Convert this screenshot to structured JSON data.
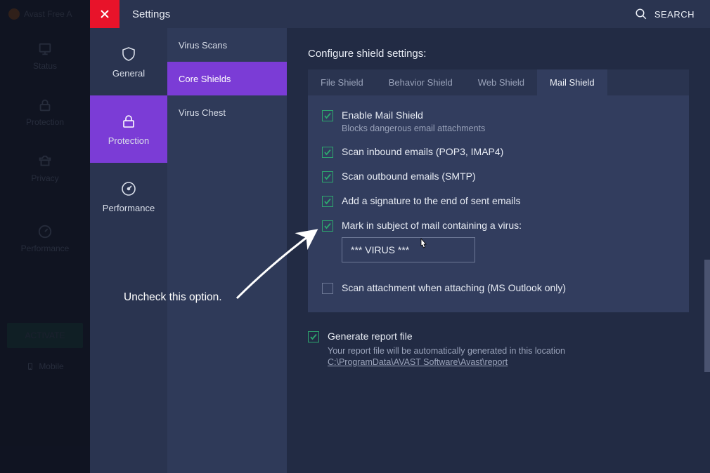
{
  "window": {
    "app_name": "Avast Free A",
    "title": "Settings",
    "search_label": "SEARCH"
  },
  "leftbar": {
    "items": [
      {
        "label": "Status"
      },
      {
        "label": "Protection"
      },
      {
        "label": "Privacy"
      },
      {
        "label": "Performance"
      }
    ],
    "activate": "ACTIVATE",
    "mobile": "Mobile"
  },
  "panel1": [
    {
      "label": "General"
    },
    {
      "label": "Protection"
    },
    {
      "label": "Performance"
    }
  ],
  "panel2": [
    {
      "label": "Virus Scans"
    },
    {
      "label": "Core Shields"
    },
    {
      "label": "Virus Chest"
    }
  ],
  "main": {
    "title": "Configure shield settings:",
    "tabs": [
      {
        "label": "File Shield"
      },
      {
        "label": "Behavior Shield"
      },
      {
        "label": "Web Shield"
      },
      {
        "label": "Mail Shield"
      }
    ],
    "options": {
      "enable": {
        "label": "Enable Mail Shield",
        "sub": "Blocks dangerous email attachments",
        "checked": true
      },
      "inbound": {
        "label": "Scan inbound emails (POP3, IMAP4)",
        "checked": true
      },
      "outbound": {
        "label": "Scan outbound emails (SMTP)",
        "checked": true
      },
      "signature": {
        "label": "Add a signature to the end of sent emails",
        "checked": true
      },
      "mark": {
        "label": "Mark in subject of mail containing a virus:",
        "checked": true,
        "value": "*** VIRUS ***"
      },
      "attach": {
        "label": "Scan attachment when attaching (MS Outlook only)",
        "checked": false
      }
    },
    "report": {
      "label": "Generate report file",
      "sub": "Your report file will be automatically generated in this location",
      "link": "C:\\ProgramData\\AVAST Software\\Avast\\report",
      "checked": true
    }
  },
  "annotation": "Uncheck this option."
}
